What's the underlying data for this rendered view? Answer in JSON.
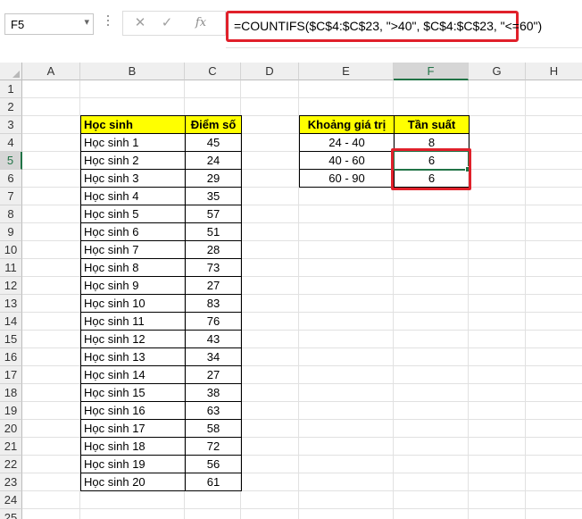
{
  "formula_bar": {
    "name_box": "F5",
    "formula": "=COUNTIFS($C$4:$C$23, \">40\", $C$4:$C$23, \"<=60\")",
    "cancel_icon": "✕",
    "enter_icon": "✓",
    "insert_function_icon": "fx"
  },
  "columns": [
    "A",
    "B",
    "C",
    "D",
    "E",
    "F",
    "G",
    "H"
  ],
  "rows": [
    "1",
    "2",
    "3",
    "4",
    "5",
    "6",
    "7",
    "8",
    "9",
    "10",
    "11",
    "12",
    "13",
    "14",
    "15",
    "16",
    "17",
    "18",
    "19",
    "20",
    "21",
    "22",
    "23",
    "24",
    "25"
  ],
  "students_table": {
    "header_name": "Học sinh",
    "header_score": "Điểm số",
    "rows": [
      {
        "name": "Học sinh 1",
        "score": "45"
      },
      {
        "name": "Học sinh 2",
        "score": "24"
      },
      {
        "name": "Học sinh 3",
        "score": "29"
      },
      {
        "name": "Học sinh 4",
        "score": "35"
      },
      {
        "name": "Học sinh 5",
        "score": "57"
      },
      {
        "name": "Học sinh 6",
        "score": "51"
      },
      {
        "name": "Học sinh 7",
        "score": "28"
      },
      {
        "name": "Học sinh 8",
        "score": "73"
      },
      {
        "name": "Học sinh 9",
        "score": "27"
      },
      {
        "name": "Học sinh 10",
        "score": "83"
      },
      {
        "name": "Học sinh 11",
        "score": "76"
      },
      {
        "name": "Học sinh 12",
        "score": "43"
      },
      {
        "name": "Học sinh 13",
        "score": "34"
      },
      {
        "name": "Học sinh 14",
        "score": "27"
      },
      {
        "name": "Học sinh 15",
        "score": "38"
      },
      {
        "name": "Học sinh 16",
        "score": "63"
      },
      {
        "name": "Học sinh 17",
        "score": "58"
      },
      {
        "name": "Học sinh 18",
        "score": "72"
      },
      {
        "name": "Học sinh 19",
        "score": "56"
      },
      {
        "name": "Học sinh 20",
        "score": "61"
      }
    ]
  },
  "frequency_table": {
    "header_range": "Khoảng giá trị",
    "header_freq": "Tần suất",
    "rows": [
      {
        "range": "24 - 40",
        "freq": "8"
      },
      {
        "range": "40 - 60",
        "freq": "6"
      },
      {
        "range": "60 - 90",
        "freq": "6"
      }
    ]
  },
  "selected_cell": "F5",
  "colors": {
    "accent": "#217346",
    "highlight_border": "#e0202a",
    "header_fill": "#ffff00"
  }
}
